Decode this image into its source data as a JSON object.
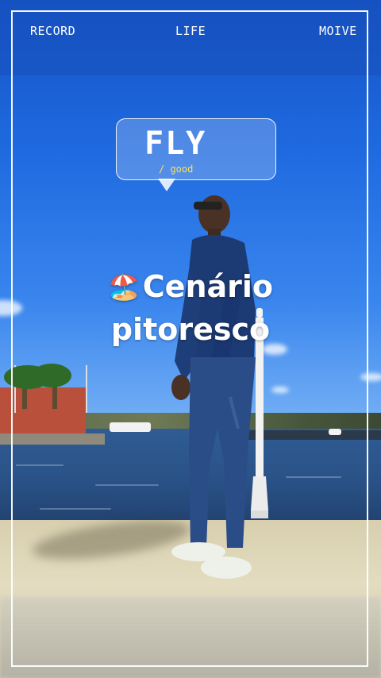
{
  "header": {
    "left": "RECORD",
    "center": "LIFE",
    "right": "MOIVE"
  },
  "bubble": {
    "title": "FLY",
    "subtitle": "/ good"
  },
  "caption": {
    "emoji": "🏖️",
    "line1": "Cenário",
    "line2": "pitoresco"
  }
}
